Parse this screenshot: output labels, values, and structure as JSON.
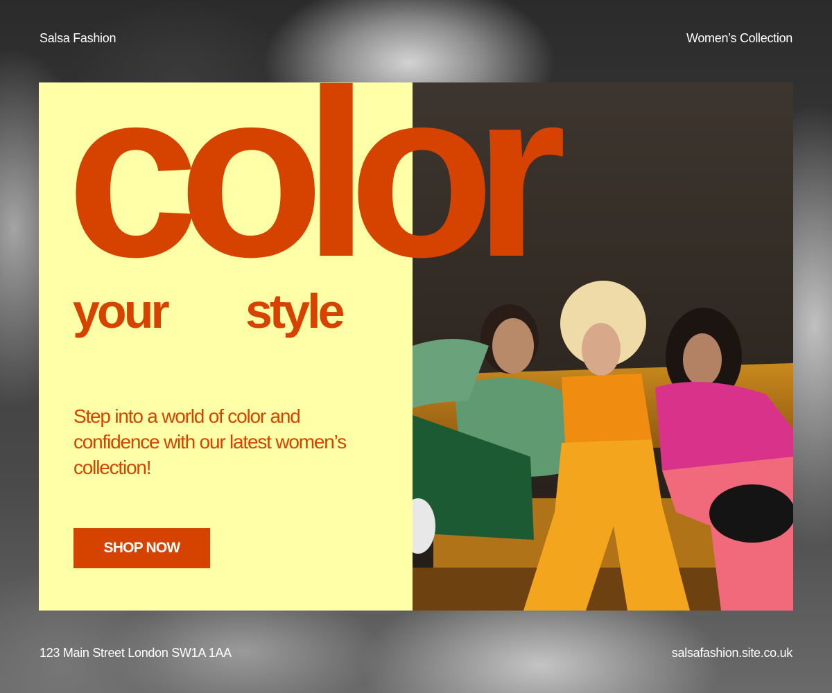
{
  "brand": "Salsa Fashion",
  "collection_label": "Women’s Collection",
  "hero": {
    "headline": "color",
    "subline_left": "your",
    "subline_right": "style",
    "description": "Step into a world of color and confidence with our latest women’s collection!",
    "cta_label": "SHOP NOW"
  },
  "footer": {
    "address": "123 Main Street London SW1A 1AA",
    "website": "salsafashion.site.co.uk"
  },
  "colors": {
    "accent": "#d64200",
    "card_background": "#ffffa8",
    "text_light": "#ffffff"
  },
  "images": {
    "background": "grayscale photo of three women on a sofa",
    "feature_photo": "three women in colorful outfits seated on an orange sofa"
  }
}
